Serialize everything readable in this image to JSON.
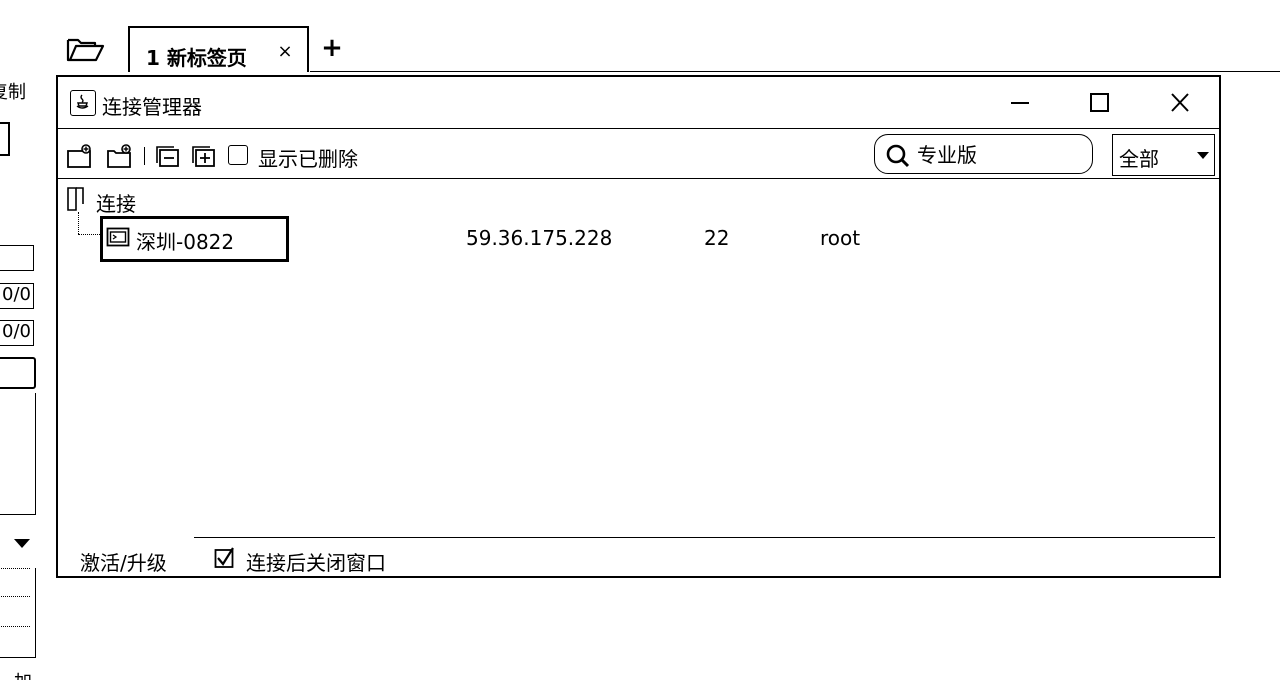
{
  "background_app": {
    "label_top": "复制",
    "field_values": [
      "",
      "0/0",
      "0/0"
    ],
    "label_bottom": "加"
  },
  "tabbar": {
    "tabs": [
      {
        "label": "1 新标签页",
        "close_symbol": "×"
      }
    ],
    "add_symbol": "+"
  },
  "dialog": {
    "title": "连接管理器",
    "toolbar": {
      "show_deleted_label": "显示已删除",
      "show_deleted_checked": false,
      "search_placeholder": "专业版",
      "filter_value": "全部"
    },
    "tree": {
      "root_label": "连接",
      "connections": [
        {
          "name": "深圳-0822",
          "host": "59.36.175.228",
          "port": "22",
          "user": "root"
        }
      ]
    },
    "footer": {
      "activate_label": "激活/升级",
      "close_after_connect_label": "连接后关闭窗口",
      "close_after_connect_checked": true
    }
  }
}
